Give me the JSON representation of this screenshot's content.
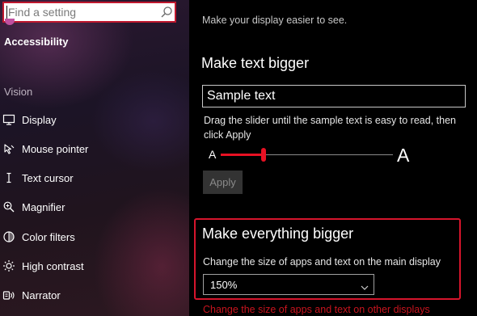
{
  "sidebar": {
    "search": {
      "placeholder": "Find a setting"
    },
    "section_title": "Accessibility",
    "group_label": "Vision",
    "items": [
      {
        "label": "Display",
        "icon": "display-icon"
      },
      {
        "label": "Mouse pointer",
        "icon": "mouse-pointer-icon"
      },
      {
        "label": "Text cursor",
        "icon": "text-cursor-icon"
      },
      {
        "label": "Magnifier",
        "icon": "magnifier-icon"
      },
      {
        "label": "Color filters",
        "icon": "color-filters-icon"
      },
      {
        "label": "High contrast",
        "icon": "high-contrast-icon"
      },
      {
        "label": "Narrator",
        "icon": "narrator-icon"
      }
    ]
  },
  "main": {
    "subtitle": "Make your display easier to see.",
    "text_bigger": {
      "heading": "Make text bigger",
      "sample_text": "Sample text",
      "instruction": "Drag the slider until the sample text is easy to read, then click Apply",
      "slider_min_label": "A",
      "slider_max_label": "A",
      "slider_value_fraction": 0.25,
      "apply_label": "Apply"
    },
    "everything_bigger": {
      "heading": "Make everything bigger",
      "scale_label": "Change the size of apps and text on the main display",
      "scale_value": "150%",
      "other_displays_link": "Change the size of apps and text on other displays"
    }
  },
  "colors": {
    "accent": "#e81123",
    "highlight_border": "#d6152c",
    "background": "#000000"
  }
}
